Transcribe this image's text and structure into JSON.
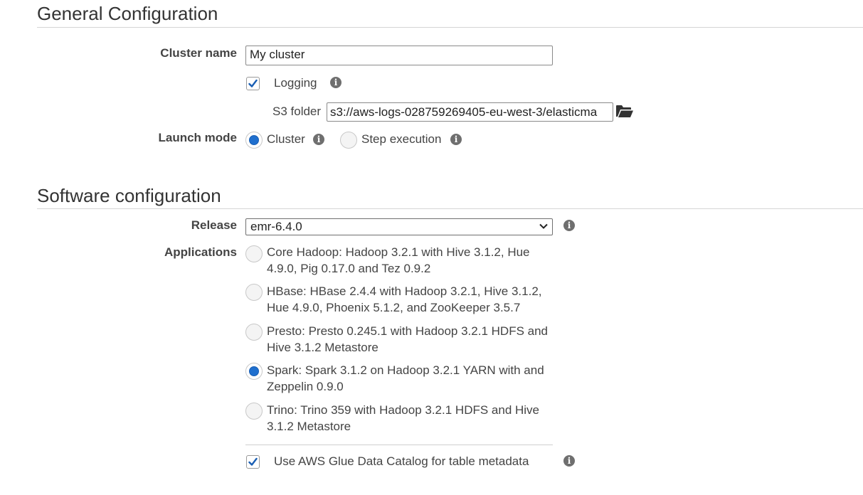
{
  "general": {
    "title": "General Configuration",
    "cluster_name_label": "Cluster name",
    "cluster_name_value": "My cluster",
    "logging_label": "Logging",
    "logging_checked": true,
    "s3_folder_label": "S3 folder",
    "s3_folder_value": "s3://aws-logs-028759269405-eu-west-3/elasticma",
    "launch_mode_label": "Launch mode",
    "launch_modes": [
      {
        "label": "Cluster",
        "selected": true
      },
      {
        "label": "Step execution",
        "selected": false
      }
    ]
  },
  "software": {
    "title": "Software configuration",
    "release_label": "Release",
    "release_value": "emr-6.4.0",
    "applications_label": "Applications",
    "applications": [
      {
        "line1": "Core Hadoop: Hadoop 3.2.1 with Hive 3.1.2, Hue",
        "line2": "4.9.0, Pig 0.17.0 and Tez 0.9.2",
        "selected": false
      },
      {
        "line1": "HBase: HBase 2.4.4 with Hadoop 3.2.1, Hive 3.1.2,",
        "line2": "Hue 4.9.0, Phoenix 5.1.2, and ZooKeeper 3.5.7",
        "selected": false
      },
      {
        "line1": "Presto: Presto 0.245.1 with Hadoop 3.2.1 HDFS and",
        "line2": "Hive 3.1.2 Metastore",
        "selected": false
      },
      {
        "line1": "Spark: Spark 3.1.2 on Hadoop 3.2.1 YARN with and",
        "line2": "Zeppelin 0.9.0",
        "selected": true
      },
      {
        "line1": "Trino: Trino 359 with Hadoop 3.2.1 HDFS and Hive",
        "line2": "3.1.2 Metastore",
        "selected": false
      }
    ],
    "glue_label": "Use AWS Glue Data Catalog for table metadata",
    "glue_checked": true
  },
  "icons": {
    "info": "i",
    "folder": "folder-open-icon",
    "check": "checkmark"
  }
}
